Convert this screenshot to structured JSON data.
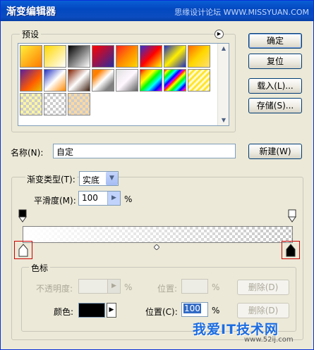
{
  "window": {
    "title": "渐变编辑器",
    "watermark_top": "思缘设计论坛 WWW.MISSYUAN.COM"
  },
  "presets": {
    "label": "预设",
    "menu_icon": "circle-arrow-icon",
    "swatches": [
      {
        "kind": "gradient",
        "css": "linear-gradient(135deg,#ffef3a,#ff7a00)"
      },
      {
        "kind": "gradient",
        "css": "linear-gradient(135deg,#ffd800,#ffffff)"
      },
      {
        "kind": "gradient",
        "css": "linear-gradient(135deg,#000000,#ffffff)"
      },
      {
        "kind": "gradient",
        "css": "linear-gradient(135deg,#ff0000,#2b2b9f)"
      },
      {
        "kind": "gradient",
        "css": "linear-gradient(135deg,#ff2020,#ff8a00 50%,#ffd800)"
      },
      {
        "kind": "gradient",
        "css": "linear-gradient(135deg,#3030d0,#ff0000 50%,#ffff00)"
      },
      {
        "kind": "gradient",
        "css": "linear-gradient(135deg,#1f2fc0,#ffef00 50%,#1f2fc0)"
      },
      {
        "kind": "gradient",
        "css": "linear-gradient(135deg,#ff6a00,#ffd800 50%,#ffe070)"
      },
      {
        "kind": "gradient",
        "css": "linear-gradient(135deg,#5b1e9c,#ff5b00 60%,#e8c000)"
      },
      {
        "kind": "gradient",
        "css": "linear-gradient(135deg,#2030c0,#ffffff 50%,#ff8800)"
      },
      {
        "kind": "gradient",
        "css": "linear-gradient(135deg,#802000,#ffffff 50%,#402010)"
      },
      {
        "kind": "gradient",
        "css": "linear-gradient(135deg,#ff8000 20%,#ffffff 50%,#808080 80%)"
      },
      {
        "kind": "gradient",
        "css": "linear-gradient(135deg,#e0e0e0,#fff8ff 50%,#606060)"
      },
      {
        "kind": "gradient",
        "css": "linear-gradient(135deg,red,orange,yellow,lime,cyan,blue,magenta)"
      },
      {
        "kind": "gradient",
        "css": "repeating-linear-gradient(135deg,red 0,yellow 4px,lime 8px,cyan 12px,blue 16px,magenta 20px)"
      },
      {
        "kind": "gradient",
        "css": "repeating-linear-gradient(135deg,#ffe000 0,#fff 3px,#ffe000 6px)"
      },
      {
        "kind": "checker-yellow",
        "css": ""
      },
      {
        "kind": "checker",
        "css": ""
      },
      {
        "kind": "checker-orange",
        "css": ""
      }
    ],
    "scroll_up": "▲",
    "scroll_down": "▼"
  },
  "buttons": {
    "ok": "确定",
    "reset": "复位",
    "load": "载入(L)...",
    "save": "存储(S)...",
    "new": "新建(W)"
  },
  "name_field": {
    "label": "名称(N):",
    "value": "自定"
  },
  "gradient_type": {
    "label": "渐变类型(T):",
    "value": "实底"
  },
  "smoothness": {
    "label": "平滑度(M):",
    "value": "100",
    "unit": "%"
  },
  "color_stops": {
    "group_label": "色标",
    "opacity_label": "不透明度:",
    "opacity_unit": "%",
    "position_label_top": "位置:",
    "position_unit_top": "%",
    "delete_top": "删除(D)",
    "color_label": "颜色:",
    "color_value": "#000000",
    "position_label": "位置(C):",
    "position_value": "100",
    "position_unit": "%",
    "delete_bottom": "删除(D)"
  },
  "bottom_watermark": {
    "text": "我爱IT技术网",
    "url": "www.52ij.com"
  }
}
